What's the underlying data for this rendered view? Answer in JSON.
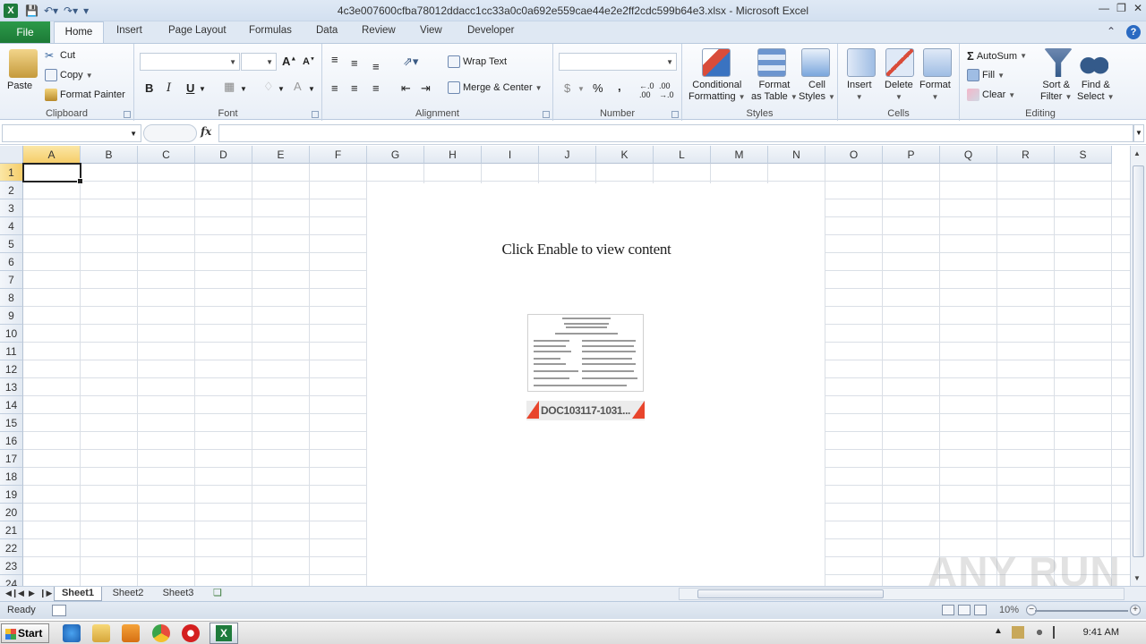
{
  "window": {
    "title": "4c3e007600cfba78012ddacc1cc33a0c0a692e559cae44e2e2ff2cdc599b64e3.xlsx  -  Microsoft Excel"
  },
  "tabs": [
    "File",
    "Home",
    "Insert",
    "Page Layout",
    "Formulas",
    "Data",
    "Review",
    "View",
    "Developer"
  ],
  "ribbon": {
    "clipboard": {
      "label": "Clipboard",
      "paste": "Paste",
      "cut": "Cut",
      "copy": "Copy",
      "format_painter": "Format Painter"
    },
    "font": {
      "label": "Font",
      "bold": "B",
      "italic": "I",
      "underline": "U"
    },
    "alignment": {
      "label": "Alignment",
      "wrap_text": "Wrap Text",
      "merge_center": "Merge & Center"
    },
    "number": {
      "label": "Number",
      "currency": "$",
      "percent": "%",
      "comma": ","
    },
    "styles": {
      "label": "Styles",
      "conditional_1": "Conditional",
      "conditional_2": "Formatting",
      "format_table_1": "Format",
      "format_table_2": "as Table",
      "cell_styles_1": "Cell",
      "cell_styles_2": "Styles"
    },
    "cells": {
      "label": "Cells",
      "insert": "Insert",
      "delete": "Delete",
      "format": "Format"
    },
    "editing": {
      "label": "Editing",
      "autosum": "AutoSum",
      "fill": "Fill",
      "clear": "Clear",
      "sort_1": "Sort &",
      "sort_2": "Filter",
      "find_1": "Find &",
      "find_2": "Select"
    }
  },
  "formula_bar": {
    "fx": "fx",
    "name_box": "",
    "formula": ""
  },
  "grid": {
    "columns": [
      "A",
      "B",
      "C",
      "D",
      "E",
      "F",
      "G",
      "H",
      "I",
      "J",
      "K",
      "L",
      "M",
      "N",
      "O",
      "P",
      "Q",
      "R",
      "S"
    ],
    "rows": [
      "1",
      "2",
      "3",
      "4",
      "5",
      "6",
      "7",
      "8",
      "9",
      "10",
      "11",
      "12",
      "13",
      "14",
      "15",
      "16",
      "17",
      "18",
      "19",
      "20",
      "21",
      "22",
      "23",
      "24"
    ],
    "selected_column": "A",
    "selected_row": "1"
  },
  "embedded": {
    "message": "Click Enable to view content",
    "doc_caption": "DOC103117-1031...",
    "accent_color": "#e8452c"
  },
  "sheets": [
    "Sheet1",
    "Sheet2",
    "Sheet3"
  ],
  "status": {
    "ready": "Ready",
    "zoom": "10%"
  },
  "taskbar": {
    "start": "Start",
    "clock": "9:41 AM"
  },
  "watermark": "ANY RUN"
}
